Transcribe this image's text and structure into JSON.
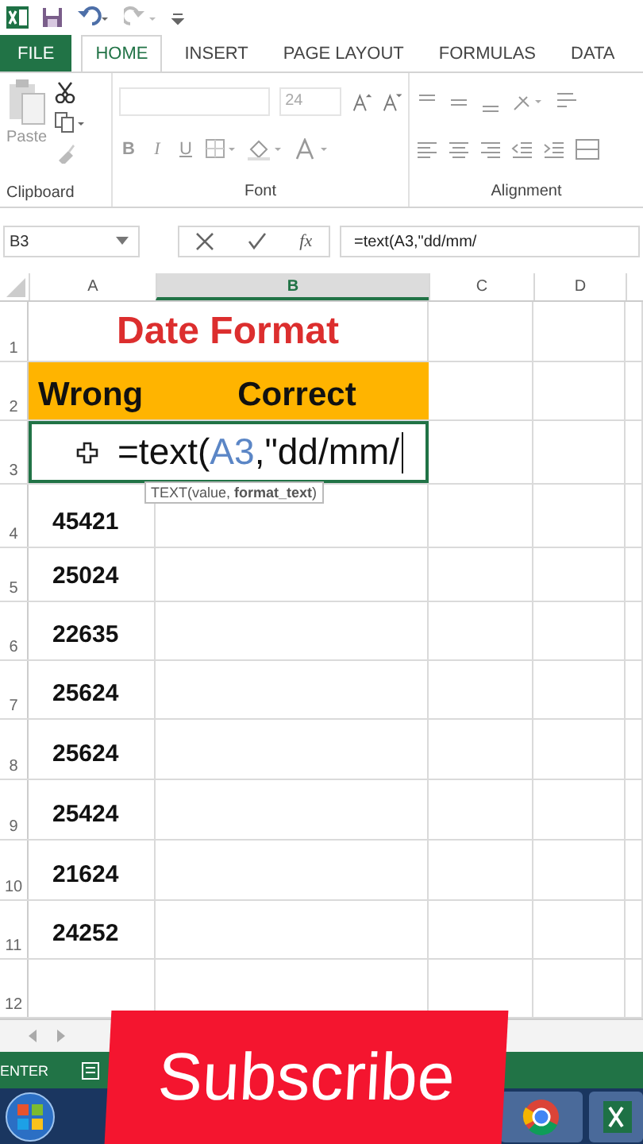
{
  "tabs": [
    {
      "label": "FILE",
      "kind": "file",
      "selected": false
    },
    {
      "label": "HOME",
      "kind": "tab",
      "selected": true
    },
    {
      "label": "INSERT",
      "kind": "tab",
      "selected": false
    },
    {
      "label": "PAGE LAYOUT",
      "kind": "tab",
      "selected": false
    },
    {
      "label": "FORMULAS",
      "kind": "tab",
      "selected": false
    },
    {
      "label": "DATA",
      "kind": "tab",
      "selected": false
    }
  ],
  "ribbon": {
    "paste": "Paste",
    "font_size": "24",
    "format_buttons": [
      "B",
      "I",
      "U"
    ],
    "groups": [
      "Clipboard",
      "Font",
      "Alignment"
    ]
  },
  "formula_bar": {
    "name_box": "B3",
    "fx": "fx",
    "formula": "=text(A3,\"dd/mm/"
  },
  "columns": [
    {
      "label": "A",
      "selected": false
    },
    {
      "label": "B",
      "selected": true
    },
    {
      "label": "C",
      "selected": false
    },
    {
      "label": "D",
      "selected": false
    }
  ],
  "row_numbers": [
    "1",
    "2",
    "3",
    "4",
    "5",
    "6",
    "7",
    "8",
    "9",
    "10",
    "11",
    "12"
  ],
  "title": "Date Format",
  "headers": [
    "Wrong",
    "Correct"
  ],
  "editing": {
    "before": "=text(",
    "ref": "A3",
    "after": ",\"dd/mm/"
  },
  "tooltip": "TEXT(value, **format_text**)",
  "values": [
    "45421",
    "25024",
    "22635",
    "25624",
    "25624",
    "25424",
    "21624",
    "24252"
  ],
  "status": "ENTER",
  "overlay": "Subscribe"
}
